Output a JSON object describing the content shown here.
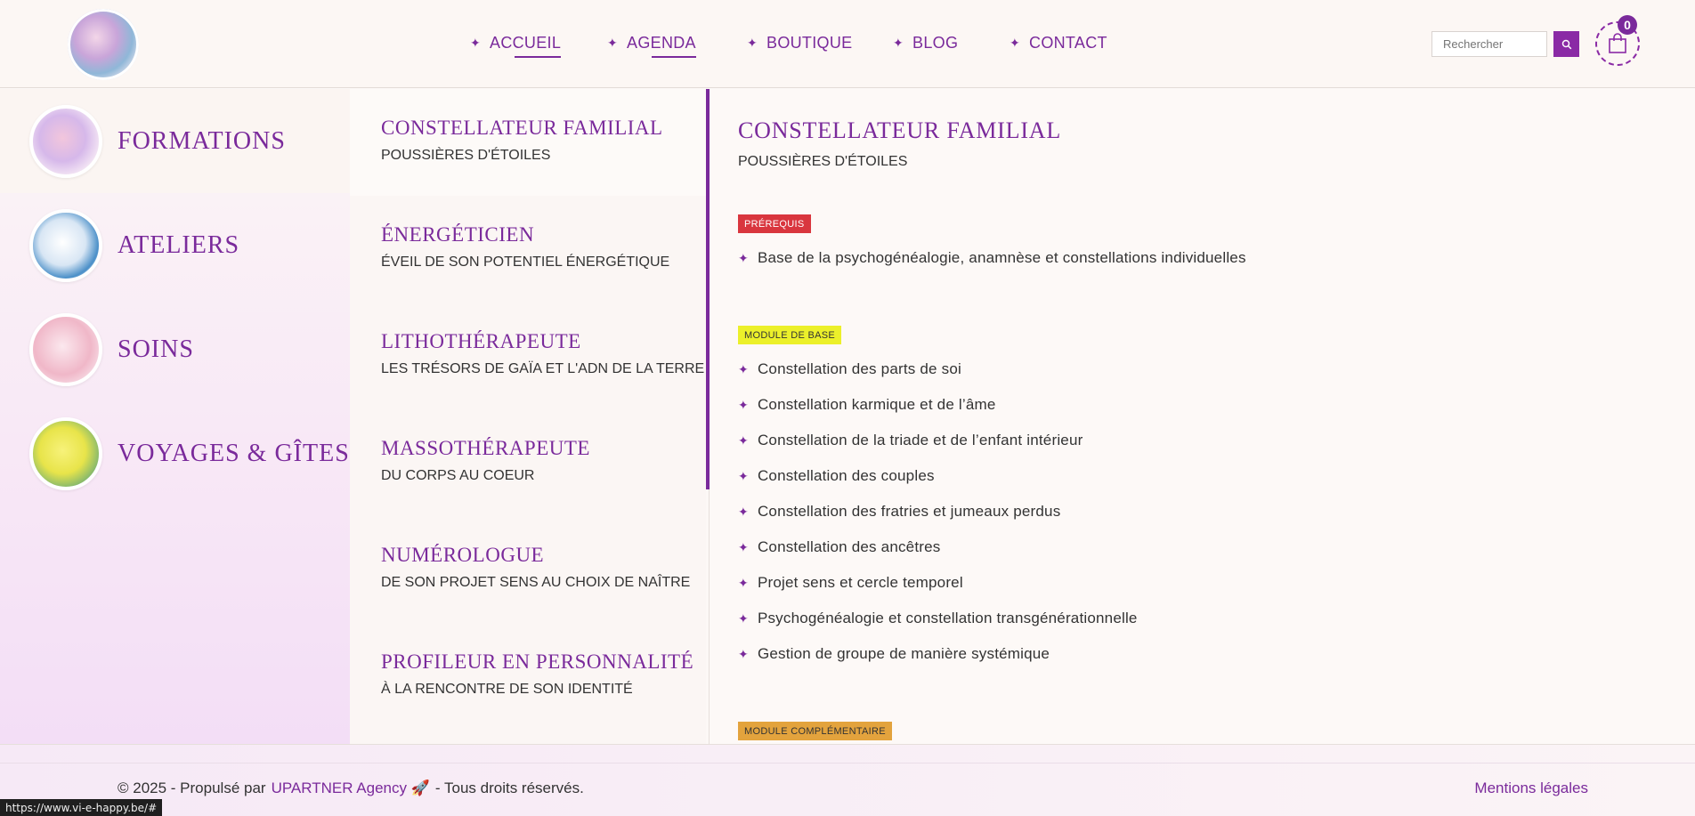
{
  "header": {
    "nav": [
      {
        "label": "ACCUEIL",
        "underline": true
      },
      {
        "label": "AGENDA",
        "underline": true
      },
      {
        "label": "BOUTIQUE",
        "underline": false
      },
      {
        "label": "BLOG",
        "underline": false
      },
      {
        "label": "CONTACT",
        "underline": false
      }
    ],
    "search_placeholder": "Rechercher",
    "cart_count": "0"
  },
  "categories": [
    {
      "label": "FORMATIONS",
      "active": true
    },
    {
      "label": "ATELIERS",
      "active": false
    },
    {
      "label": "SOINS",
      "active": false
    },
    {
      "label": "VOYAGES & GÎTES",
      "active": false
    }
  ],
  "formations": [
    {
      "title": "CONSTELLATEUR FAMILIAL",
      "subtitle": "POUSSIÈRES D'ÉTOILES"
    },
    {
      "title": "ÉNERGÉTICIEN",
      "subtitle": "ÉVEIL DE SON POTENTIEL ÉNERGÉTIQUE"
    },
    {
      "title": "LITHOTHÉRAPEUTE",
      "subtitle": "LES TRÉSORS DE GAÏA ET L'ADN DE LA TERRE"
    },
    {
      "title": "MASSOTHÉRAPEUTE",
      "subtitle": "DU CORPS AU COEUR"
    },
    {
      "title": "NUMÉROLOGUE",
      "subtitle": "DE SON PROJET SENS AU CHOIX DE NAÎTRE"
    },
    {
      "title": "PROFILEUR EN PERSONNALITÉ",
      "subtitle": "À LA RENCONTRE DE SON IDENTITÉ"
    }
  ],
  "detail": {
    "title": "CONSTELLATEUR FAMILIAL",
    "subtitle": "POUSSIÈRES D'ÉTOILES",
    "prerequis_label": "PRÉREQUIS",
    "prerequis": [
      "Base de la psychogénéalogie, anamnèse et constellations individuelles"
    ],
    "module_base_label": "MODULE DE BASE",
    "module_base": [
      "Constellation des parts de soi",
      "Constellation karmique et de l’âme",
      "Constellation de la triade et de l’enfant intérieur",
      "Constellation des couples",
      "Constellation des fratries et jumeaux perdus",
      "Constellation des ancêtres",
      "Projet sens et cercle temporel",
      "Psychogénéalogie et constellation transgénérationnelle",
      "Gestion de groupe de manière systémique"
    ],
    "module_comp_label": "MODULE COMPLÉMENTAIRE"
  },
  "footer": {
    "copyright": "© 2025 - Propulsé par",
    "agency": "UPARTNER Agency",
    "rights": "- Tous droits réservés.",
    "mentions": "Mentions légales"
  },
  "status_url": "https://www.vi-e-happy.be/#",
  "colors": {
    "accent": "#7a2a9b",
    "badge_red": "#d9363e",
    "badge_yellow": "#ecf02a",
    "badge_orange": "#e3a33d"
  }
}
